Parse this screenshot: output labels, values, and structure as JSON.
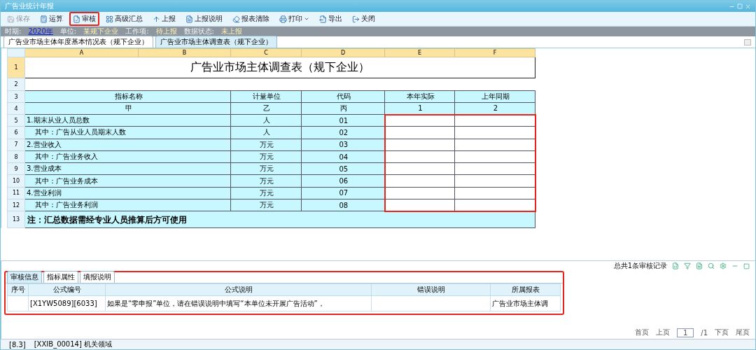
{
  "window": {
    "title": "广告业统计年报"
  },
  "toolbar": [
    {
      "label": "保存",
      "disabled": true,
      "highlighted": false,
      "kind": "save"
    },
    {
      "label": "运算",
      "disabled": false,
      "highlighted": false,
      "kind": "calc"
    },
    {
      "label": "审核",
      "disabled": false,
      "highlighted": true,
      "kind": "check"
    },
    {
      "label": "高级汇总",
      "disabled": false,
      "highlighted": false,
      "kind": "sum"
    },
    {
      "label": "上报",
      "disabled": false,
      "highlighted": false,
      "kind": "upload"
    },
    {
      "label": "上报说明",
      "disabled": false,
      "highlighted": false,
      "kind": "note"
    },
    {
      "label": "报表清除",
      "disabled": false,
      "highlighted": false,
      "kind": "clear"
    },
    {
      "label": "打印",
      "disabled": false,
      "highlighted": false,
      "kind": "print"
    },
    {
      "label": "导出",
      "disabled": false,
      "highlighted": false,
      "kind": "export"
    },
    {
      "label": "关闭",
      "disabled": false,
      "highlighted": false,
      "kind": "close"
    }
  ],
  "info_bar": [
    {
      "label": "时期:",
      "value": "2020年",
      "kind": "link"
    },
    {
      "label": "单位:",
      "value": "某规下企业",
      "kind": "text"
    },
    {
      "label": "工作项:",
      "value": "待上报",
      "kind": "text"
    },
    {
      "label": "数据状态:",
      "value": "未上报",
      "kind": "text"
    }
  ],
  "sheet_tabs": [
    {
      "label": "广告业市场主体年度基本情况表（规下企业）",
      "selected": true
    },
    {
      "label": "广告业市场主体调查表（规下企业）",
      "selected": false
    }
  ],
  "sheet": {
    "columns": [
      "A",
      "B",
      "C",
      "D",
      "E",
      "F"
    ],
    "row_numbers": [
      "1",
      "2",
      "3",
      "4",
      "5",
      "6",
      "7",
      "8",
      "9",
      "10",
      "11",
      "12",
      "13"
    ],
    "title": "广告业市场主体调查表（规下企业）",
    "header_rows": [
      [
        "指标名称",
        "计量单位",
        "代码",
        "本年实际",
        "上年同期"
      ],
      [
        "甲",
        "乙",
        "丙",
        "1",
        "2"
      ]
    ],
    "items": [
      {
        "name": "1.期末从业人员总数",
        "unit": "人",
        "code": "01",
        "children": [
          {
            "name": "其中：广告从业人员期末人数",
            "unit": "人",
            "code": "02"
          }
        ]
      },
      {
        "name": "2.营业收入",
        "unit": "万元",
        "code": "03",
        "children": [
          {
            "name": "其中：广告业务收入",
            "unit": "万元",
            "code": "04"
          }
        ]
      },
      {
        "name": "3.营业成本",
        "unit": "万元",
        "code": "05",
        "children": [
          {
            "name": "其中：广告业务成本",
            "unit": "万元",
            "code": "06"
          }
        ]
      },
      {
        "name": "4.营业利润",
        "unit": "万元",
        "code": "07",
        "children": [
          {
            "name": "其中：广告业务利润",
            "unit": "万元",
            "code": "08"
          }
        ]
      }
    ],
    "inputs_highlighted": true,
    "note": "注：汇总数据需经专业人员推算后方可使用"
  },
  "bottom_panel": {
    "highlighted": true,
    "tabs": [
      {
        "label": "审核信息",
        "selected": true
      },
      {
        "label": "指标属性",
        "selected": false
      },
      {
        "label": "填报说明",
        "selected": false
      }
    ],
    "record_count": "总共1条审核记录",
    "columns": [
      "序号",
      "公式编号",
      "公式说明",
      "错误说明",
      "所属报表"
    ],
    "rows": [
      [
        "",
        "[X1YW5089][6033]",
        "如果是“零申报”单位，请在错误说明中填写“本单位未开展广告活动”，",
        "",
        "广告业市场主体调"
      ]
    ],
    "pagination": [
      "首页",
      "上页",
      "1",
      "/1",
      "下页",
      "尾页"
    ]
  },
  "status_bar": [
    "[8.3]",
    "[XXIB_00014] 机关领域"
  ]
}
